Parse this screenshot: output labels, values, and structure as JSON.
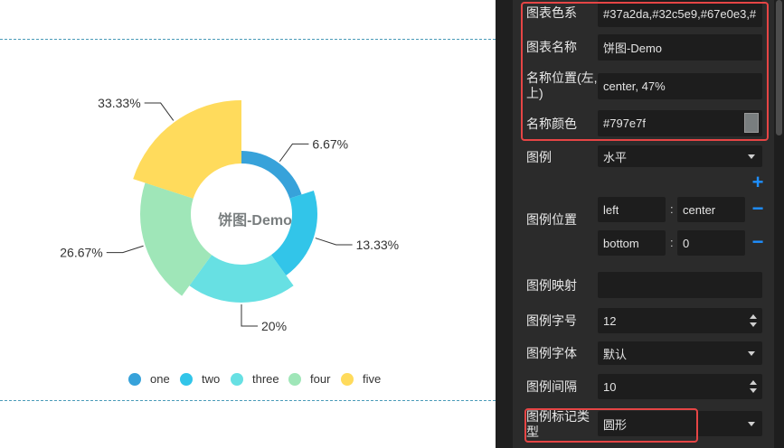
{
  "chart_data": {
    "type": "pie",
    "variant": "rose-donut",
    "title": "饼图-Demo",
    "categories": [
      "one",
      "two",
      "three",
      "four",
      "five"
    ],
    "values": [
      1,
      2,
      3,
      4,
      5
    ],
    "percent_labels": [
      "6.67%",
      "13.33%",
      "20%",
      "26.67%",
      "33.33%"
    ],
    "colors": [
      "#37a2da",
      "#32c5e9",
      "#67e0e3",
      "#9fe6b8",
      "#ffdb5c"
    ],
    "title_color": "#797e7f",
    "legend": {
      "orient": "horizontal",
      "position": "bottom-center",
      "marker": "circle"
    }
  },
  "panel": {
    "rows": {
      "palette": {
        "label": "图表色系",
        "value": "#37a2da,#32c5e9,#67e0e3,#"
      },
      "title_name": {
        "label": "图表名称",
        "value": "饼图-Demo"
      },
      "title_pos": {
        "label_line1": "名称位置(左,",
        "label_line2": "上)",
        "value": "center, 47%"
      },
      "title_color": {
        "label": "名称颜色",
        "value": "#797e7f"
      },
      "legend": {
        "label": "图例",
        "value": "水平"
      },
      "legend_pos": {
        "label": "图例位置",
        "h_key": "left",
        "h_val": "center",
        "v_key": "bottom",
        "v_val": "0",
        "colon": ":"
      },
      "legend_map": {
        "label": "图例映射",
        "value": ""
      },
      "legend_font_size": {
        "label": "图例字号",
        "value": "12"
      },
      "legend_font": {
        "label": "图例字体",
        "value": "默认"
      },
      "legend_gap": {
        "label": "图例间隔",
        "value": "10"
      },
      "legend_marker": {
        "label_line1": "图例标记类",
        "label_line2": "型",
        "value": "圆形"
      }
    },
    "add_glyph": "+",
    "remove_glyph": "−",
    "colors": {
      "panel_bg": "#2b2b2b",
      "field_bg": "#1d1d1d",
      "highlight": "#e64545",
      "accent": "#1e8fff"
    }
  }
}
